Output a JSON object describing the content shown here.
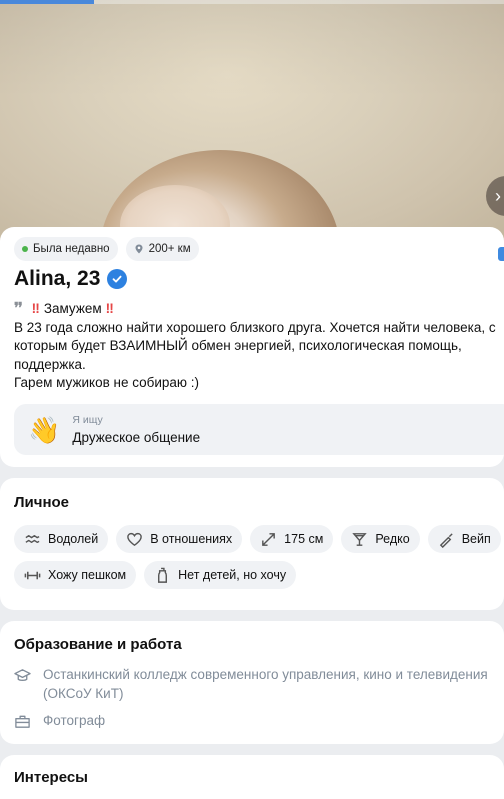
{
  "profile": {
    "status": "Была недавно",
    "distance": "200+ км",
    "name": "Alina, 23",
    "bio": {
      "headline": "Замужем",
      "lines": [
        "В 23 года сложно найти хорошего близкого друга. Хочется найти человека, с",
        "которым будет ВЗАИМНЫЙ обмен энергией, психологическая помощь,",
        "поддержка.",
        "Гарем мужиков не собираю :)"
      ]
    },
    "seeking": {
      "label": "Я ищу",
      "value": "Дружеское общение"
    }
  },
  "personal": {
    "title": "Личное",
    "tags_row1": [
      {
        "icon": "zodiac-aquarius-icon",
        "label": "Водолей"
      },
      {
        "icon": "heart-icon",
        "label": "В отношениях"
      },
      {
        "icon": "height-arrows-icon",
        "label": "175 см"
      },
      {
        "icon": "glass-icon",
        "label": "Редко"
      },
      {
        "icon": "vape-icon",
        "label": "Вейп"
      }
    ],
    "tags_row2": [
      {
        "icon": "dumbbell-icon",
        "label": "Хожу пешком"
      },
      {
        "icon": "baby-bottle-icon",
        "label": "Нет детей, но хочу"
      }
    ]
  },
  "education": {
    "title": "Образование и работа",
    "school_line1": "Останкинский колледж современного управления, кино и телевидения",
    "school_line2": "(ОКСоУ КиТ)",
    "job": "Фотограф"
  },
  "interests": {
    "title": "Интересы"
  },
  "colors": {
    "accent": "#2d81e0",
    "online": "#4bb34b",
    "alert": "#e64646",
    "muted": "#818c99"
  }
}
